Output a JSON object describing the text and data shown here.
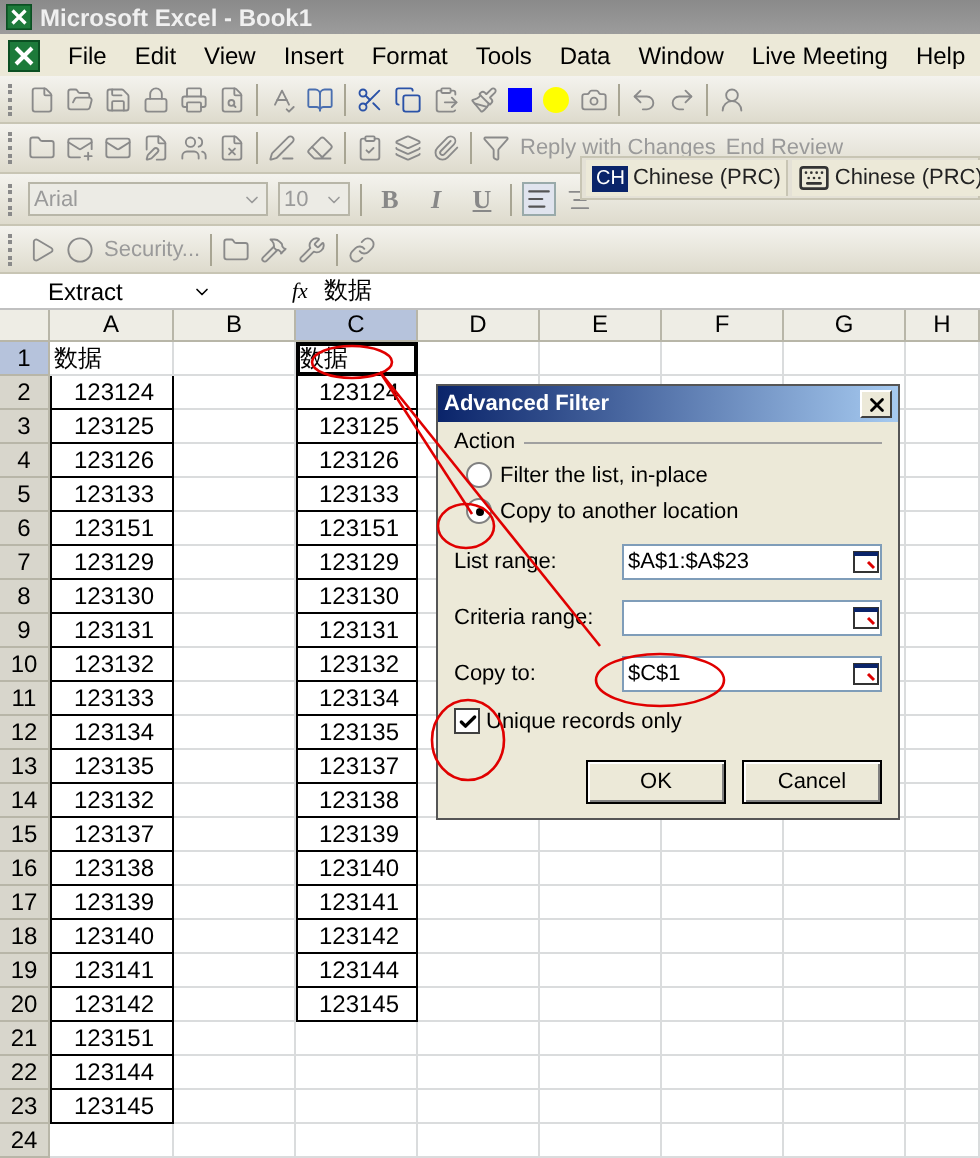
{
  "window": {
    "title": "Microsoft Excel - Book1"
  },
  "menu": [
    "File",
    "Edit",
    "View",
    "Insert",
    "Format",
    "Tools",
    "Data",
    "Window",
    "Live Meeting",
    "Help"
  ],
  "review_toolbar": [
    "Reply with Changes",
    "End Review"
  ],
  "language_bar": [
    {
      "kind": "ime",
      "code": "CH",
      "label": "Chinese (PRC)"
    },
    {
      "kind": "keyboard",
      "label": "Chinese (PRC)"
    }
  ],
  "formatting": {
    "font": "Arial",
    "size": "10",
    "bold": "B",
    "italic": "I",
    "underline": "U"
  },
  "macro_toolbar": {
    "security": "Security..."
  },
  "formula_bar": {
    "name_box": "Extract",
    "fx": "fx",
    "formula": "数据"
  },
  "sheet": {
    "columns": [
      {
        "label": "A",
        "selected": false
      },
      {
        "label": "B",
        "selected": false
      },
      {
        "label": "C",
        "selected": true
      },
      {
        "label": "D",
        "selected": false
      },
      {
        "label": "E",
        "selected": false
      },
      {
        "label": "F",
        "selected": false
      },
      {
        "label": "G",
        "selected": false
      },
      {
        "label": "H",
        "selected": false
      }
    ],
    "rows": [
      {
        "number": "1",
        "selected": true,
        "a": "数据",
        "c": "数据"
      },
      {
        "number": "2",
        "selected": false,
        "a": "123124",
        "c": "123124"
      },
      {
        "number": "3",
        "selected": false,
        "a": "123125",
        "c": "123125"
      },
      {
        "number": "4",
        "selected": false,
        "a": "123126",
        "c": "123126"
      },
      {
        "number": "5",
        "selected": false,
        "a": "123133",
        "c": "123133"
      },
      {
        "number": "6",
        "selected": false,
        "a": "123151",
        "c": "123151"
      },
      {
        "number": "7",
        "selected": false,
        "a": "123129",
        "c": "123129"
      },
      {
        "number": "8",
        "selected": false,
        "a": "123130",
        "c": "123130"
      },
      {
        "number": "9",
        "selected": false,
        "a": "123131",
        "c": "123131"
      },
      {
        "number": "10",
        "selected": false,
        "a": "123132",
        "c": "123132"
      },
      {
        "number": "11",
        "selected": false,
        "a": "123133",
        "c": "123134"
      },
      {
        "number": "12",
        "selected": false,
        "a": "123134",
        "c": "123135"
      },
      {
        "number": "13",
        "selected": false,
        "a": "123135",
        "c": "123137"
      },
      {
        "number": "14",
        "selected": false,
        "a": "123132",
        "c": "123138"
      },
      {
        "number": "15",
        "selected": false,
        "a": "123137",
        "c": "123139"
      },
      {
        "number": "16",
        "selected": false,
        "a": "123138",
        "c": "123140"
      },
      {
        "number": "17",
        "selected": false,
        "a": "123139",
        "c": "123141"
      },
      {
        "number": "18",
        "selected": false,
        "a": "123140",
        "c": "123142"
      },
      {
        "number": "19",
        "selected": false,
        "a": "123141",
        "c": "123144"
      },
      {
        "number": "20",
        "selected": false,
        "a": "123142",
        "c": "123145"
      },
      {
        "number": "21",
        "selected": false,
        "a": "123151"
      },
      {
        "number": "22",
        "selected": false,
        "a": "123144"
      },
      {
        "number": "23",
        "selected": false,
        "a": "123145"
      },
      {
        "number": "24",
        "selected": false
      }
    ]
  },
  "dialog": {
    "title": "Advanced Filter",
    "group": "Action",
    "options": [
      {
        "label": "Filter the list, in-place",
        "selected": false
      },
      {
        "label": "Copy to another location",
        "selected": true
      }
    ],
    "fields": [
      {
        "label": "List range:",
        "value": "$A$1:$A$23"
      },
      {
        "label": "Criteria range:"
      },
      {
        "label": "Copy to:",
        "value": "$C$1"
      }
    ],
    "unique": {
      "label": "Unique records only",
      "checked": true
    },
    "buttons": [
      "OK",
      "Cancel"
    ]
  }
}
